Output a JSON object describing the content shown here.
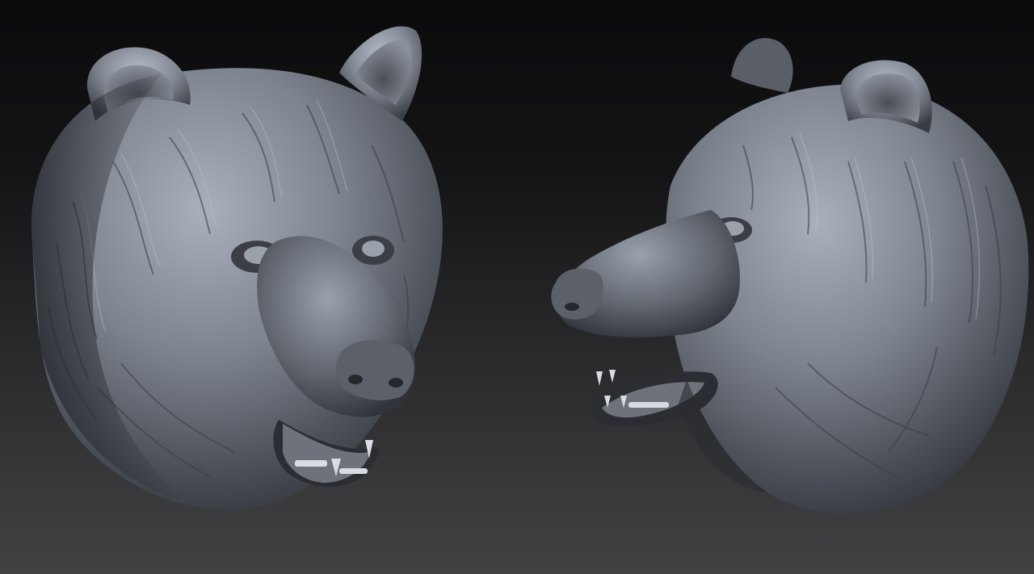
{
  "scene": {
    "description_colors": {
      "background_top": "#0b0b0c",
      "background_bottom": "#424245",
      "clay_light": "#a9b0bb",
      "clay_mid": "#6f7580",
      "clay_dark": "#2f3238"
    },
    "models": [
      {
        "name": "bear-head-front"
      },
      {
        "name": "bear-head-profile"
      }
    ]
  }
}
